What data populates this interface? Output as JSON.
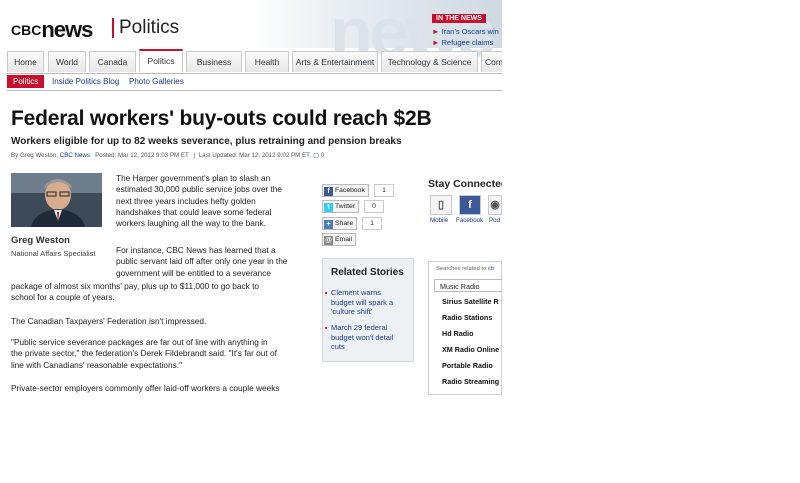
{
  "header": {
    "logo_prefix": "CBC",
    "logo_word": "news",
    "section": "Politics",
    "in_the_news": {
      "tag": "IN THE NEWS",
      "items": [
        "Iran's Oscars win",
        "Refugee claims"
      ]
    }
  },
  "nav": {
    "tabs": [
      "Home",
      "World",
      "Canada",
      "Politics",
      "Business",
      "Health",
      "Arts & Entertainment",
      "Technology & Science",
      "Comm"
    ],
    "active": "Politics",
    "sub": [
      "Politics",
      "Inside Politics Blog",
      "Photo Galleries"
    ]
  },
  "article": {
    "headline": "Federal workers' buy-outs could reach $2B",
    "subhead": "Workers eligible for up to 82 weeks severance, plus retraining and pension breaks",
    "byline": {
      "by": "By Greg Weston,",
      "outlet": "CBC News",
      "posted": "Posted: Mar 12, 2012 9:03 PM ET",
      "updated": "Last Updated: Mar 12, 2012 9:02 PM ET",
      "comments": "0"
    },
    "author": {
      "name": "Greg Weston",
      "title": "National Affairs Specialist"
    },
    "paragraphs": {
      "p1": [
        "The Harper government's plan to slash an",
        "estimated 30,000 public service jobs over the",
        "next three years includes hefty golden",
        "handshakes that could leave some federal",
        "workers laughing all the way to the bank."
      ],
      "p2_wrapped": [
        "For instance, CBC News has learned that a",
        "public servant laid off after only one year in the",
        "government will be entitled to a severance"
      ],
      "p2_full": [
        "package of almost six months' pay, plus up to $11,000 to go back to",
        "school for a couple of years."
      ],
      "p3": "The Canadian Taxpayers' Federation isn't impressed.",
      "p4": [
        "\"Public service severance packages are far out of line with anything in",
        "the private sector,\" the federation's Derek Fildebrandt said. \"It's far out of",
        "line with Canadians' reasonable expectations.\""
      ],
      "p5": "Private-sector employers commonly offer laid-off workers a couple weeks"
    }
  },
  "share": [
    {
      "label": "Facebook",
      "count": "1",
      "icon": "f"
    },
    {
      "label": "Twitter",
      "count": "0",
      "icon": "t"
    },
    {
      "label": "Share",
      "count": "1",
      "icon": "+"
    },
    {
      "label": "Email",
      "count": "",
      "icon": "@"
    }
  ],
  "related": {
    "title": "Related Stories",
    "items": [
      [
        "Clement warns",
        "budget will spark a",
        "'culture shift'"
      ],
      [
        "March 29 federal",
        "budget won't detail",
        "cuts"
      ]
    ]
  },
  "stay_connected": {
    "title": "Stay Connected",
    "items": [
      "Mobile",
      "Facebook",
      "Pod"
    ]
  },
  "searches": {
    "label": "Searches related to",
    "label_link": "cb",
    "first": "Music Radio",
    "items": [
      "Sirius Satellite R",
      "Radio Stations",
      "Hd Radio",
      "XM Radio Online",
      "Portable Radio",
      "Radio Streaming"
    ]
  },
  "colors": {
    "accent": "#c8102e",
    "link": "#1a3c8a"
  }
}
